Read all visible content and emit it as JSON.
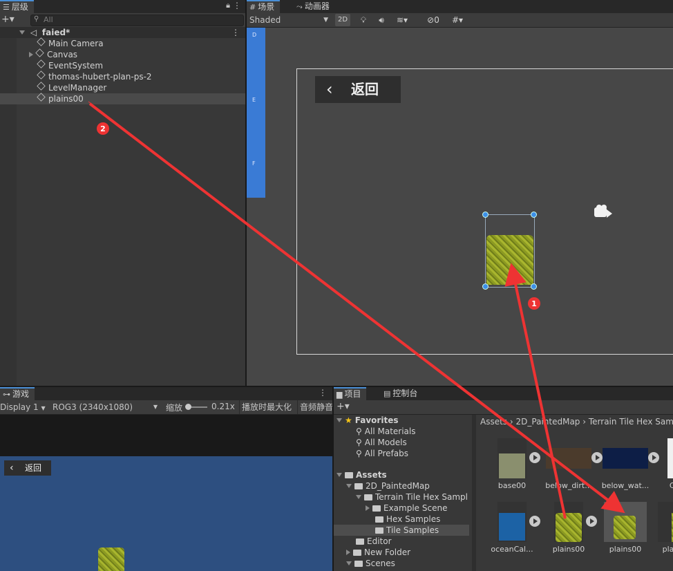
{
  "hierarchy": {
    "tab_label": "层级",
    "search_placeholder": "All",
    "scene_name": "faied*",
    "items": [
      "Main Camera",
      "Canvas",
      "EventSystem",
      "thomas-hubert-plan-ps-2",
      "LevelManager",
      "plains00"
    ]
  },
  "scene": {
    "tab_scene": "场景",
    "tab_animator": "动画器",
    "shading_mode": "Shaded",
    "btn_2d": "2D",
    "gizmo_count": "0",
    "back_label": "返回",
    "ruler_letters": [
      "D",
      "E",
      "F"
    ]
  },
  "game": {
    "tab_label": "游戏",
    "display": "Display 1",
    "resolution": "ROG3 (2340x1080)",
    "scale_label": "缩放",
    "scale_value": "0.21x",
    "maximize_label": "播放时最大化",
    "mute_label": "音频静音",
    "back_label": "返回"
  },
  "project": {
    "tab_project": "项目",
    "tab_console": "控制台",
    "favorites_label": "Favorites",
    "favorites": [
      "All Materials",
      "All Models",
      "All Prefabs"
    ],
    "assets_label": "Assets",
    "tree": {
      "painted_map": "2D_PaintedMap",
      "terrain": "Terrain Tile Hex Sampl",
      "example": "Example Scene",
      "hex": "Hex Samples",
      "tile": "Tile Samples",
      "editor": "Editor",
      "new_folder": "New Folder",
      "scenes": "Scenes"
    },
    "breadcrumb": [
      "Assets",
      "2D_PaintedMap",
      "Terrain Tile Hex Sam"
    ],
    "assets": [
      "base00",
      "below_dirt...",
      "below_wat...",
      "Cr",
      "oceanCal...",
      "plains00",
      "plains00",
      "pla"
    ]
  },
  "annotations": {
    "marker1": "1",
    "marker2": "2"
  },
  "colors": {
    "accent": "#4a8fd6",
    "annotation": "#ee3333",
    "scene_bg": "#474747",
    "game_bg": "#2d4f80"
  }
}
